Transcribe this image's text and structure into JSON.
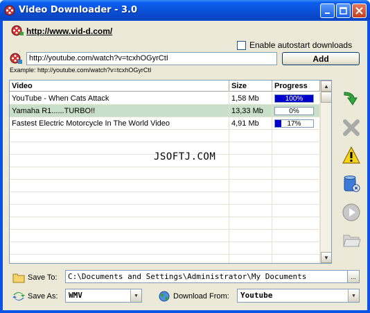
{
  "window": {
    "title": "Video Downloader - 3.0",
    "controls": [
      "minimize",
      "maximize",
      "close"
    ]
  },
  "site_link": "http://www.vid-d.com/",
  "autostart": {
    "label": "Enable autostart downloads",
    "checked": false
  },
  "url_input": {
    "value": "http://youtube.com/watch?v=tcxhOGyrCtI"
  },
  "add_button": "Add",
  "example_text": "Example: http://youtube.com/watch?v=tcxhOGyrCtI",
  "grid": {
    "columns": [
      "Video",
      "Size",
      "Progress"
    ],
    "rows": [
      {
        "video": "YouTube - When Cats Attack",
        "size": "1,58 Mb",
        "progress": 1.0,
        "progress_label": "100%",
        "selected": false
      },
      {
        "video": "Yamaha R1......TURBO!!",
        "size": "13,33 Mb",
        "progress": 0.0,
        "progress_label": "0%",
        "selected": true
      },
      {
        "video": "Fastest Electric Motorcycle In The World Video",
        "size": "4,91 Mb",
        "progress": 0.17,
        "progress_label": "17%",
        "selected": false
      }
    ]
  },
  "watermark": "JSOFTJ.COM",
  "side_icons": [
    "download-arrow-icon",
    "delete-x-icon",
    "warning-icon",
    "clear-list-icon",
    "play-icon",
    "open-folder-icon"
  ],
  "save_to": {
    "label": "Save To:",
    "value": "C:\\Documents and Settings\\Administrator\\My Documents",
    "browse": "..."
  },
  "save_as": {
    "label": "Save As:",
    "value": "WMV"
  },
  "download_from": {
    "label": "Download From:",
    "value": "Youtube"
  },
  "colors": {
    "title_bar": "#0a53e3",
    "client_bg": "#ece9d8",
    "selected_row": "#c9dfc9",
    "progress_fill": "#0000cc"
  }
}
